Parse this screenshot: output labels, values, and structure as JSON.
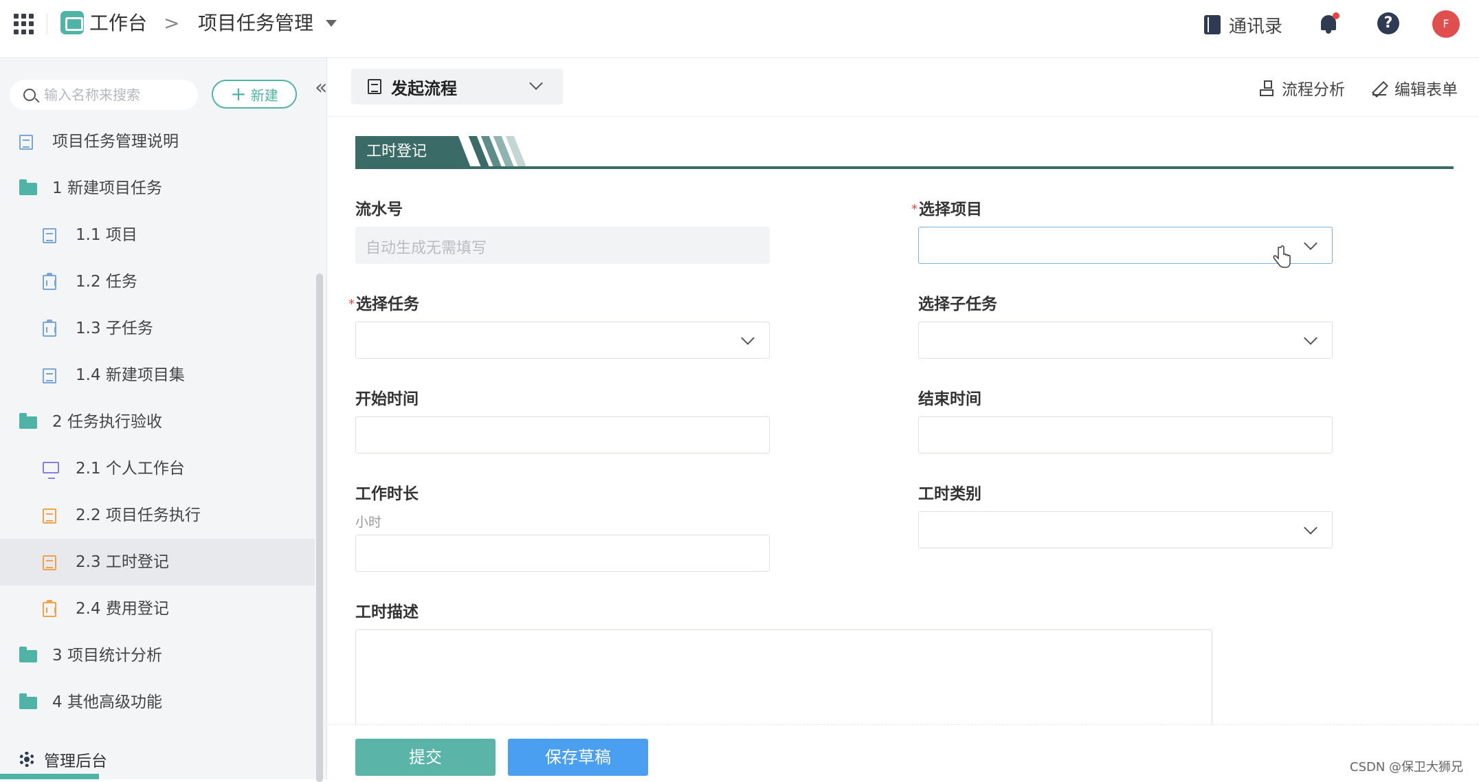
{
  "header": {
    "app_name": "工作台",
    "breadcrumb_sep": ">",
    "page": "项目任务管理",
    "contacts": "通讯录",
    "help": "?",
    "avatar_letter": "F",
    "brand_color": "#4fb3a6"
  },
  "sidebar": {
    "search_placeholder": "输入名称来搜索",
    "new_label": "新建",
    "collapse": "«",
    "items": [
      {
        "label": "项目任务管理说明",
        "icon": "document-icon",
        "level": 0
      },
      {
        "label": "1 新建项目任务",
        "icon": "folder-icon",
        "level": 0
      },
      {
        "label": "1.1 项目",
        "icon": "document-icon",
        "level": 1
      },
      {
        "label": "1.2 任务",
        "icon": "clipboard-icon",
        "level": 1
      },
      {
        "label": "1.3 子任务",
        "icon": "clipboard-icon",
        "level": 1
      },
      {
        "label": "1.4 新建项目集",
        "icon": "document-icon",
        "level": 1
      },
      {
        "label": "2 任务执行验收",
        "icon": "folder-icon",
        "level": 0
      },
      {
        "label": "2.1 个人工作台",
        "icon": "monitor-icon",
        "level": 1
      },
      {
        "label": "2.2 项目任务执行",
        "icon": "document-icon",
        "level": 1
      },
      {
        "label": "2.3 工时登记",
        "icon": "document-icon",
        "level": 1,
        "selected": true
      },
      {
        "label": "2.4 费用登记",
        "icon": "clipboard-icon",
        "level": 1
      },
      {
        "label": "3 项目统计分析",
        "icon": "folder-icon",
        "level": 0
      },
      {
        "label": "4 其他高级功能",
        "icon": "folder-icon",
        "level": 0
      }
    ],
    "admin": "管理后台"
  },
  "toolbar": {
    "launch_flow": "发起流程",
    "flow_analysis": "流程分析",
    "edit_form": "编辑表单"
  },
  "form": {
    "section_title": "工时登记",
    "required_mark": "*",
    "serial": {
      "label": "流水号",
      "placeholder": "自动生成无需填写"
    },
    "project": {
      "label": "选择项目",
      "required": true,
      "value": ""
    },
    "task": {
      "label": "选择任务",
      "required": true,
      "value": ""
    },
    "subtask": {
      "label": "选择子任务",
      "value": ""
    },
    "start_time": {
      "label": "开始时间",
      "value": ""
    },
    "end_time": {
      "label": "结束时间",
      "value": ""
    },
    "duration": {
      "label": "工作时长",
      "unit": "小时",
      "value": ""
    },
    "hour_type": {
      "label": "工时类别",
      "value": ""
    },
    "description": {
      "label": "工时描述",
      "value": ""
    }
  },
  "actions": {
    "submit": "提交",
    "save_draft": "保存草稿"
  },
  "watermark": "CSDN @保卫大狮兄"
}
